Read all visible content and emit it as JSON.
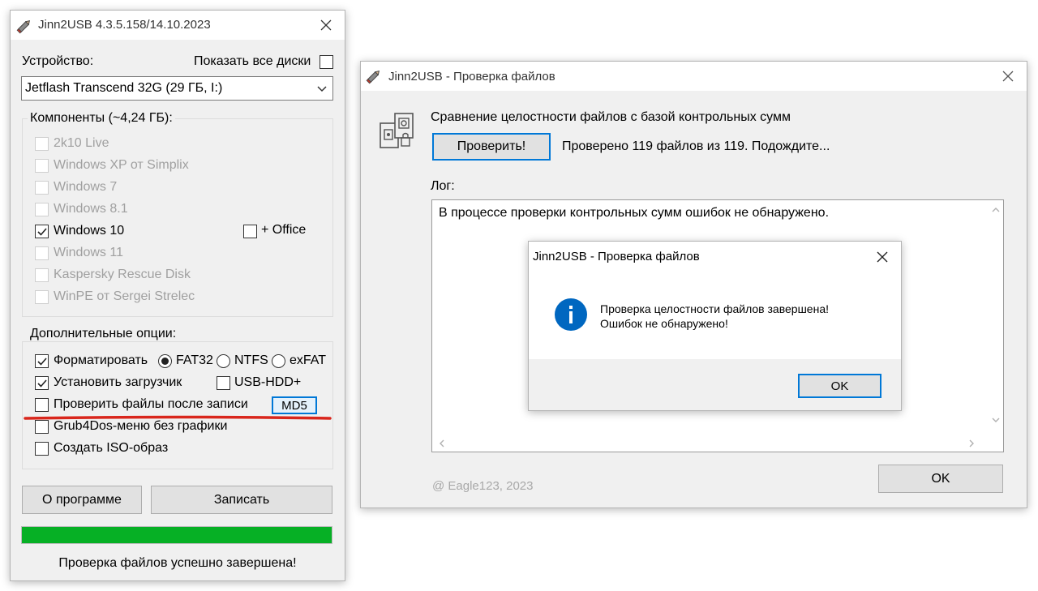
{
  "main_window": {
    "title": "Jinn2USB 4.3.5.158/14.10.2023",
    "device_label": "Устройство:",
    "show_all_disks_label": "Показать все диски",
    "device_value": "Jetflash Transcend 32G (29 ГБ, I:)",
    "components_title": "Компоненты (~4,24 ГБ):",
    "components": [
      {
        "label": "2k10 Live",
        "checked": false,
        "enabled": false
      },
      {
        "label": "Windows XP от Simplix",
        "checked": false,
        "enabled": false
      },
      {
        "label": "Windows 7",
        "checked": false,
        "enabled": false
      },
      {
        "label": "Windows 8.1",
        "checked": false,
        "enabled": false
      },
      {
        "label": "Windows 10",
        "checked": true,
        "enabled": true
      },
      {
        "label": "Windows 11",
        "checked": false,
        "enabled": false
      },
      {
        "label": "Kaspersky Rescue Disk",
        "checked": false,
        "enabled": false
      },
      {
        "label": "WinPE от Sergei Strelec",
        "checked": false,
        "enabled": false
      }
    ],
    "office_label": "+ Office",
    "options_title": "Дополнительные опции:",
    "format_label": "Форматировать",
    "fs_fat32": "FAT32",
    "fs_ntfs": "NTFS",
    "fs_exfat": "exFAT",
    "bootloader_label": "Установить загрузчик",
    "usbhdd_label": "USB-HDD+",
    "verify_label": "Проверить файлы после записи",
    "md5_label": "MD5",
    "grub_label": "Grub4Dos-меню без графики",
    "iso_label": "Создать ISO-образ",
    "about_button": "О программе",
    "write_button": "Записать",
    "progress_fraction": 1.0,
    "status_text": "Проверка файлов успешно завершена!"
  },
  "verify_window": {
    "title": "Jinn2USB - Проверка файлов",
    "heading": "Сравнение целостности файлов с базой контрольных сумм",
    "check_button": "Проверить!",
    "progress_text": "Проверено 119 файлов из 119. Подождите...",
    "log_label": "Лог:",
    "log_text": "В процессе проверки контрольных сумм ошибок не обнаружено.",
    "footer_text": "@ Eagle123, 2023",
    "ok_button": "OK"
  },
  "message_box": {
    "title": "Jinn2USB - Проверка файлов",
    "line1": "Проверка целостности файлов завершена!",
    "line2": "Ошибок не обнаружено!",
    "ok_button": "OK"
  },
  "colors": {
    "progress": "#06b025",
    "accent": "#0078d7",
    "info_icon": "#0067c0",
    "underline": "#d9261c"
  }
}
